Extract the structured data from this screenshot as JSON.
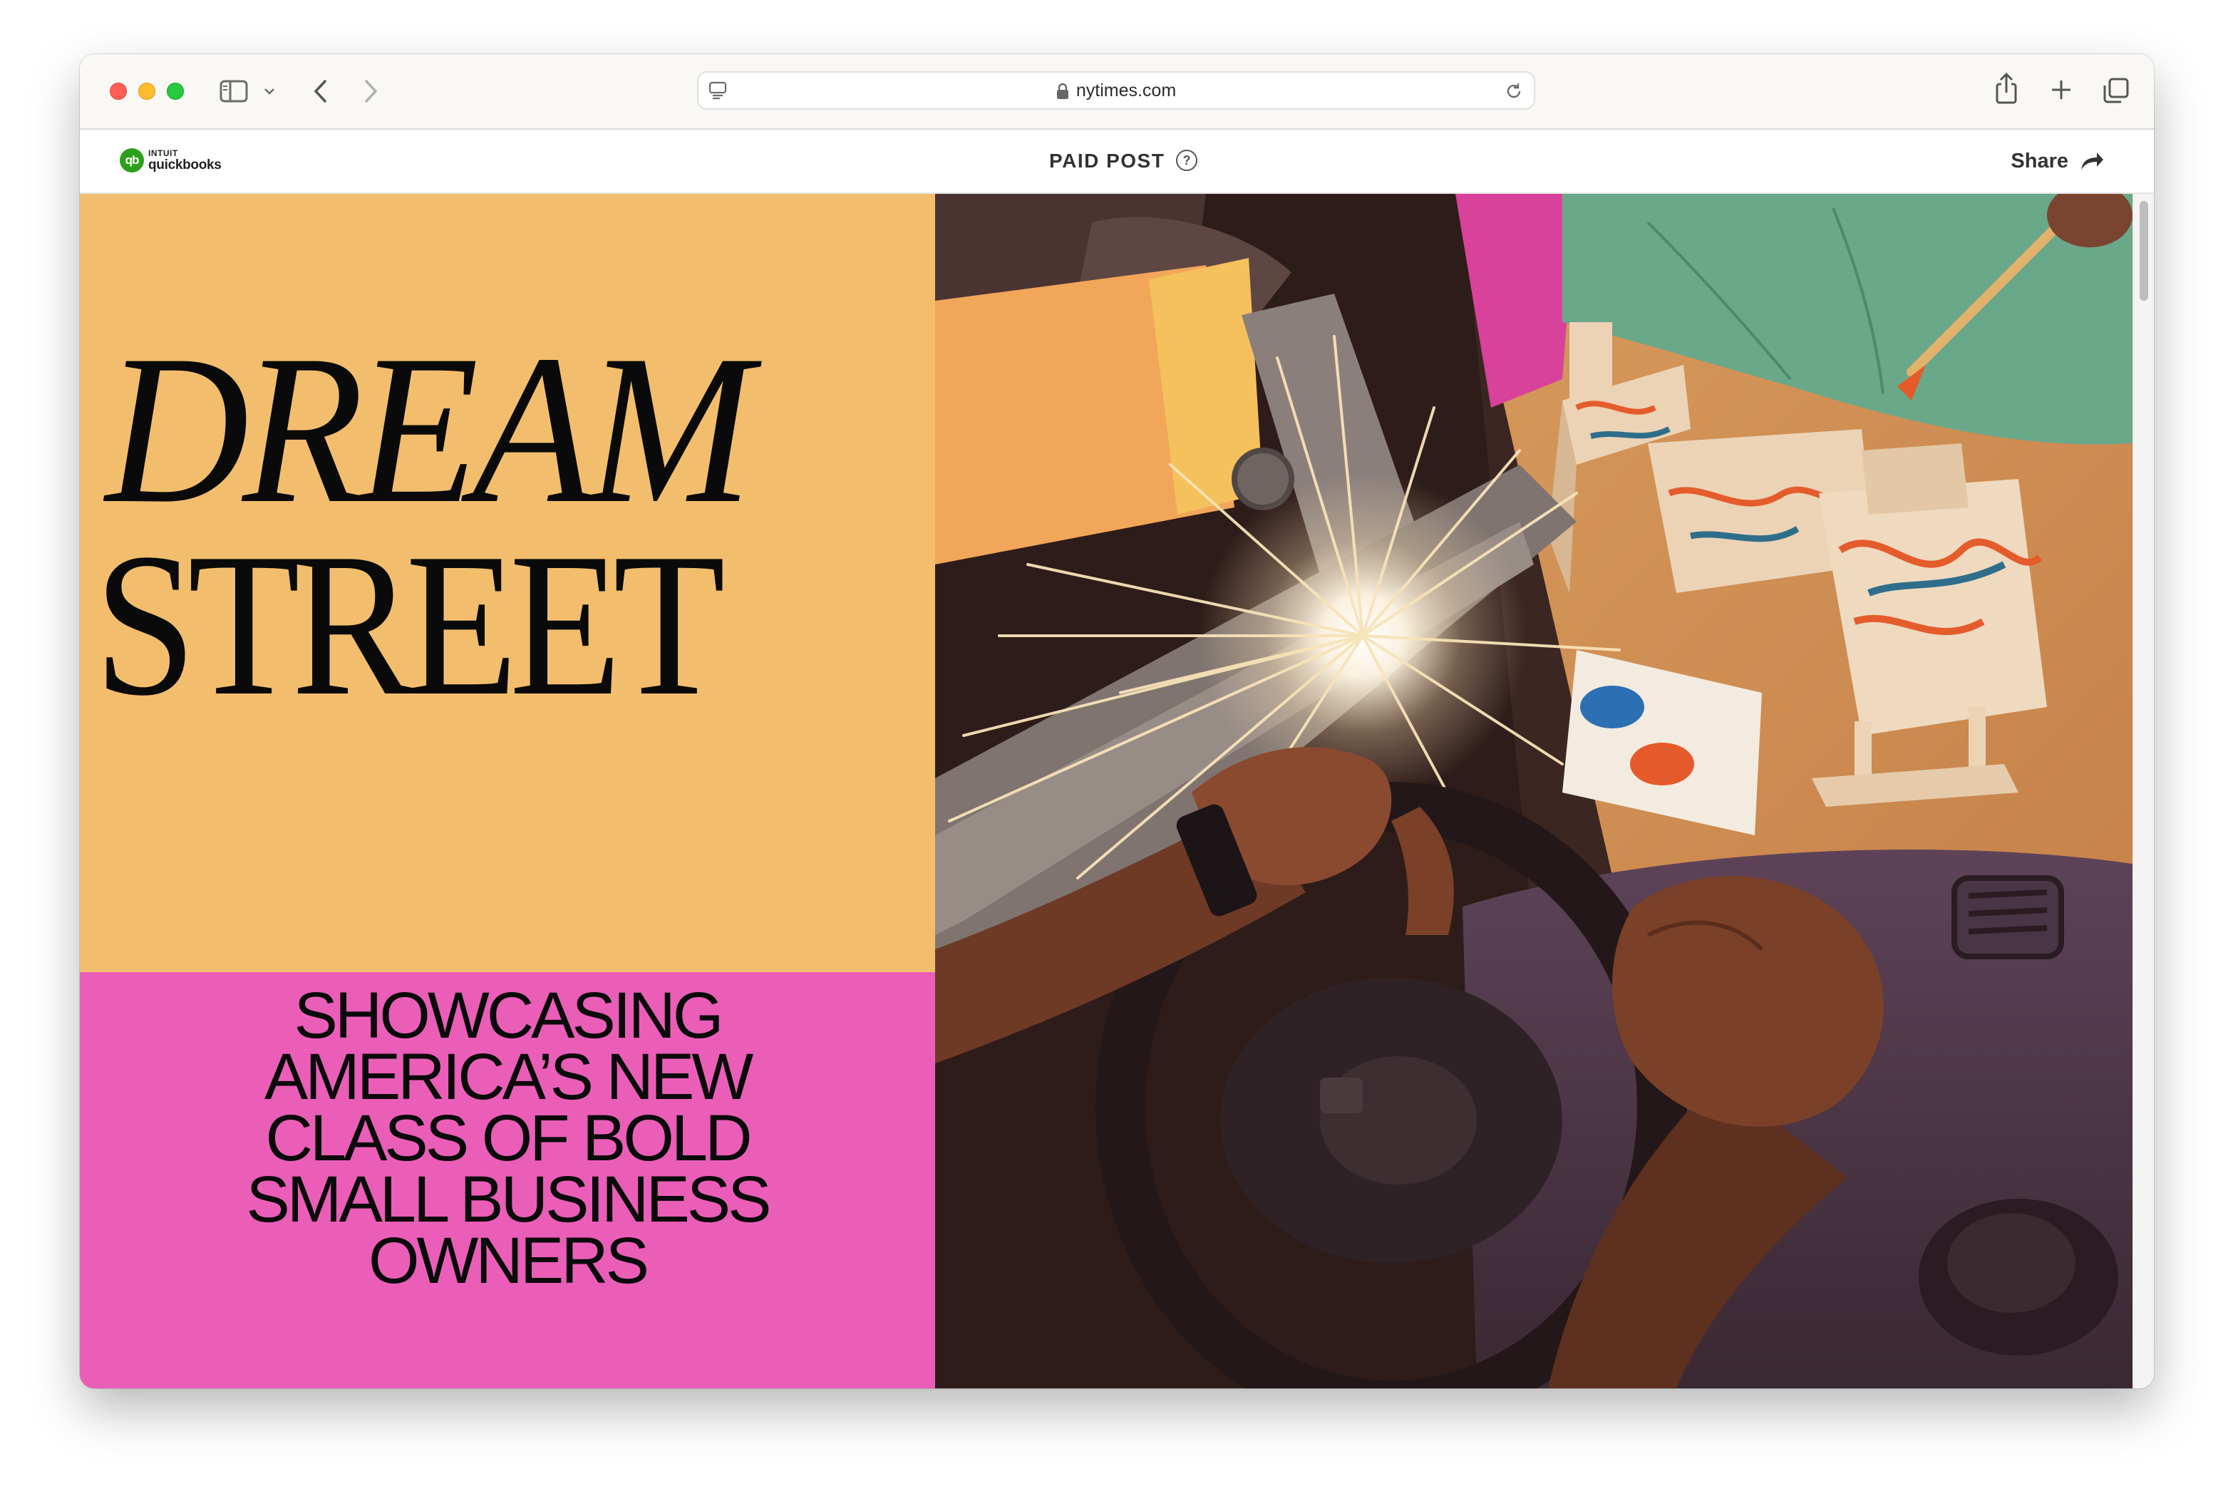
{
  "browser": {
    "url": "nytimes.com",
    "traffic_lights": {
      "close": "#ff5f57",
      "minimize": "#febc2e",
      "zoom": "#28c840"
    }
  },
  "site_header": {
    "logo": {
      "mark": "qb",
      "brand_top": "INTUIT",
      "brand_name": "quickbooks",
      "color": "#2ca01c"
    },
    "label": "PAID POST",
    "help": "?",
    "share_label": "Share"
  },
  "hero": {
    "title_line1": "DREAM",
    "title_line2": "STREET",
    "tagline": [
      "SHOWCASING",
      "AMERICA’S NEW",
      "CLASS OF BOLD",
      "SMALL BUSINESS",
      "OWNERS"
    ],
    "colors": {
      "top_panel": "#f2be6d",
      "bottom_panel": "#ea5eb8",
      "text": "#0a0a0a"
    }
  }
}
